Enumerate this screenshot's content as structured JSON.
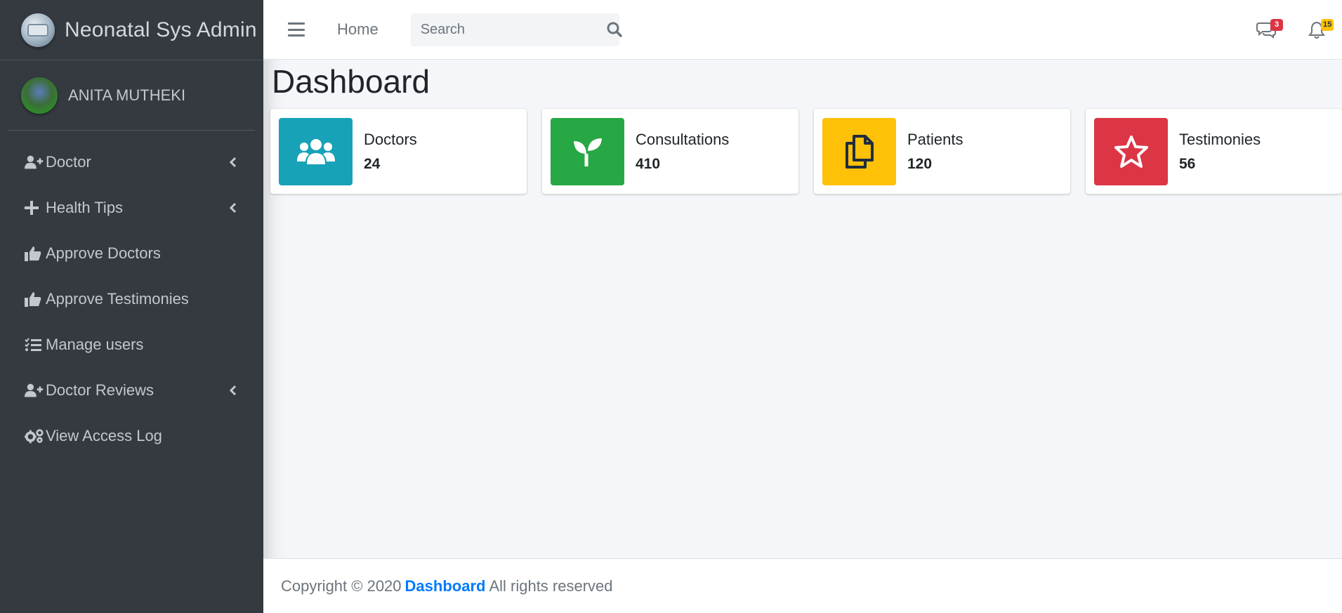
{
  "brand": {
    "title": "Neonatal Sys Admin"
  },
  "user": {
    "name": "ANITA MUTHEKI"
  },
  "sidebar": {
    "items": [
      {
        "label": "Doctor",
        "icon": "user-plus-icon",
        "has_chevron": true
      },
      {
        "label": "Health Tips",
        "icon": "plus-icon",
        "has_chevron": true
      },
      {
        "label": "Approve Doctors",
        "icon": "thumbs-up-icon",
        "has_chevron": false
      },
      {
        "label": "Approve Testimonies",
        "icon": "thumbs-up-icon",
        "has_chevron": false
      },
      {
        "label": "Manage users",
        "icon": "tasks-icon",
        "has_chevron": false
      },
      {
        "label": "Doctor Reviews",
        "icon": "user-plus-icon",
        "has_chevron": true
      },
      {
        "label": "View Access Log",
        "icon": "cogs-icon",
        "has_chevron": false
      }
    ]
  },
  "navbar": {
    "home_label": "Home",
    "search_placeholder": "Search",
    "messages_count": "3",
    "notifications_count": "15"
  },
  "page": {
    "title": "Dashboard"
  },
  "cards": [
    {
      "label": "Doctors",
      "value": "24",
      "color": "#17a2b8",
      "icon": "users-icon"
    },
    {
      "label": "Consultations",
      "value": "410",
      "color": "#28a745",
      "icon": "seedling-icon"
    },
    {
      "label": "Patients",
      "value": "120",
      "color": "#ffc107",
      "icon": "copy-icon"
    },
    {
      "label": "Testimonies",
      "value": "56",
      "color": "#dc3545",
      "icon": "star-icon"
    }
  ],
  "footer": {
    "prefix": "Copyright © 2020",
    "link": "Dashboard",
    "suffix": "All rights reserved"
  }
}
